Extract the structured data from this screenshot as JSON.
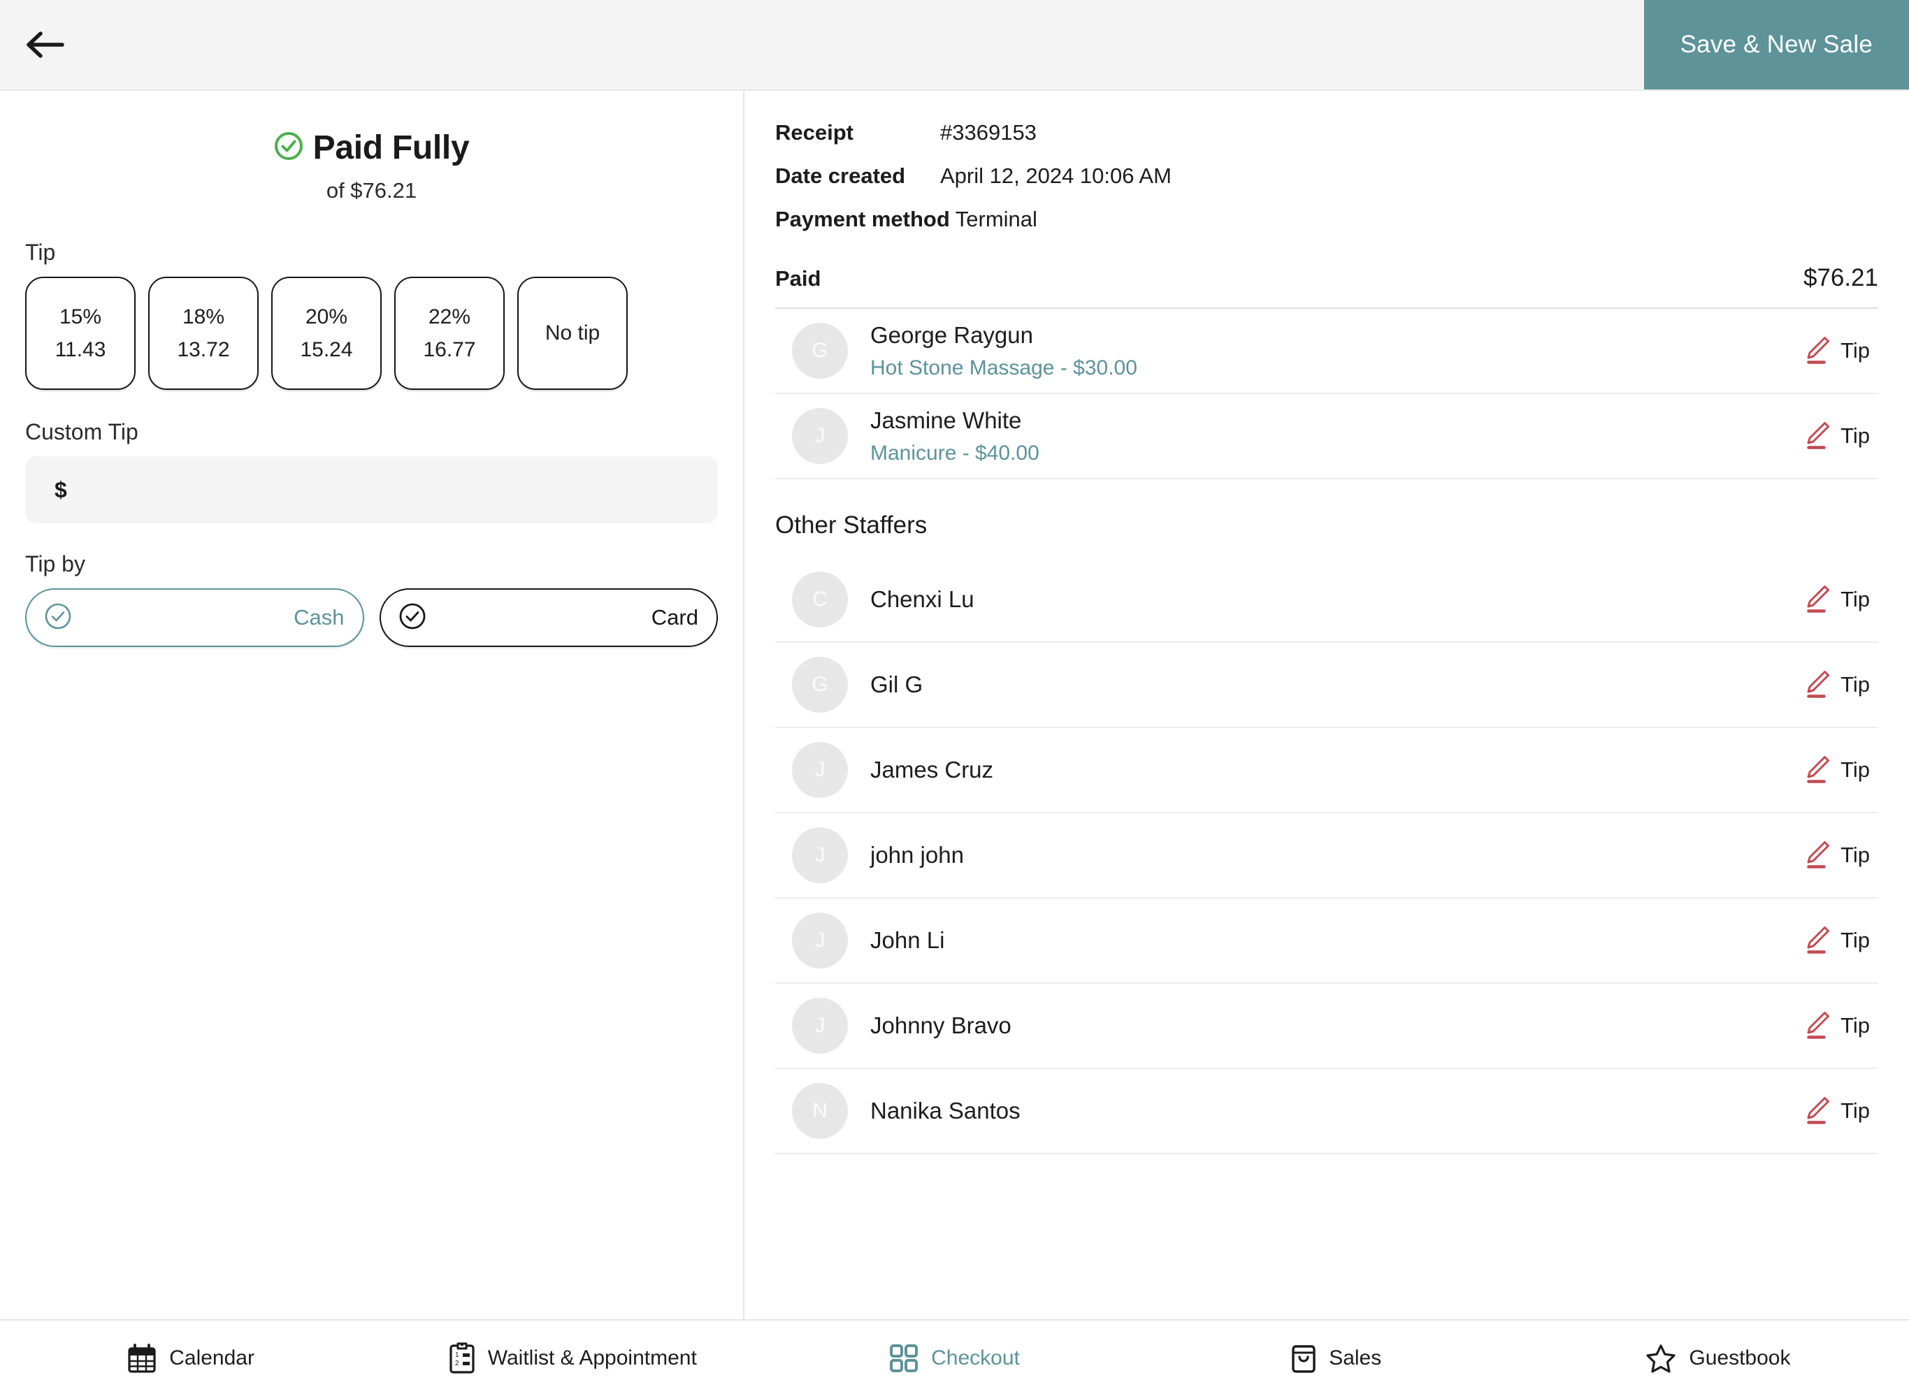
{
  "header": {
    "back_icon": "arrow-left-icon",
    "save_label": "Save & New Sale",
    "accent_color": "#5d9399"
  },
  "payment": {
    "status_icon": "check-circle-icon",
    "status_title": "Paid Fully",
    "status_subtitle": "of $76.21",
    "status_color": "#4caf50",
    "tip_section_label": "Tip",
    "tip_options": [
      {
        "percent": "15%",
        "amount": "11.43"
      },
      {
        "percent": "18%",
        "amount": "13.72"
      },
      {
        "percent": "20%",
        "amount": "15.24"
      },
      {
        "percent": "22%",
        "amount": "16.77"
      }
    ],
    "no_tip_label": "No tip",
    "custom_tip_label": "Custom Tip",
    "custom_tip_prefix": "$",
    "custom_tip_value": "",
    "custom_tip_placeholder": "",
    "tip_by_label": "Tip by",
    "tip_by_options": [
      {
        "label": "Cash",
        "selected": true
      },
      {
        "label": "Card",
        "selected": false
      }
    ]
  },
  "receipt": {
    "receipt_label": "Receipt",
    "receipt_value": "#3369153",
    "date_label": "Date created",
    "date_value": "April 12, 2024 10:06 AM",
    "method_label": "Payment method",
    "method_value": "Terminal",
    "paid_label": "Paid",
    "paid_value": "$76.21"
  },
  "assigned_staff": [
    {
      "initial": "G",
      "name": "George Raygun",
      "service": "Hot Stone Massage - $30.00",
      "tip_label": "Tip"
    },
    {
      "initial": "J",
      "name": "Jasmine White",
      "service": "Manicure - $40.00",
      "tip_label": "Tip"
    }
  ],
  "other_staffers": {
    "heading": "Other Staffers",
    "items": [
      {
        "initial": "C",
        "name": "Chenxi Lu",
        "tip_label": "Tip"
      },
      {
        "initial": "G",
        "name": "Gil G",
        "tip_label": "Tip"
      },
      {
        "initial": "J",
        "name": "James Cruz",
        "tip_label": "Tip"
      },
      {
        "initial": "J",
        "name": "john john",
        "tip_label": "Tip"
      },
      {
        "initial": "J",
        "name": "John Li",
        "tip_label": "Tip"
      },
      {
        "initial": "J",
        "name": "Johnny Bravo",
        "tip_label": "Tip"
      },
      {
        "initial": "N",
        "name": "Nanika Santos",
        "tip_label": "Tip"
      }
    ]
  },
  "bottom_nav": {
    "items": [
      {
        "label": "Calendar",
        "icon": "calendar-icon",
        "active": false
      },
      {
        "label": "Waitlist & Appointment",
        "icon": "clipboard-list-icon",
        "active": false
      },
      {
        "label": "Checkout",
        "icon": "grid-squares-icon",
        "active": true
      },
      {
        "label": "Sales",
        "icon": "shopping-bag-icon",
        "active": false
      },
      {
        "label": "Guestbook",
        "icon": "star-icon",
        "active": false
      }
    ]
  }
}
